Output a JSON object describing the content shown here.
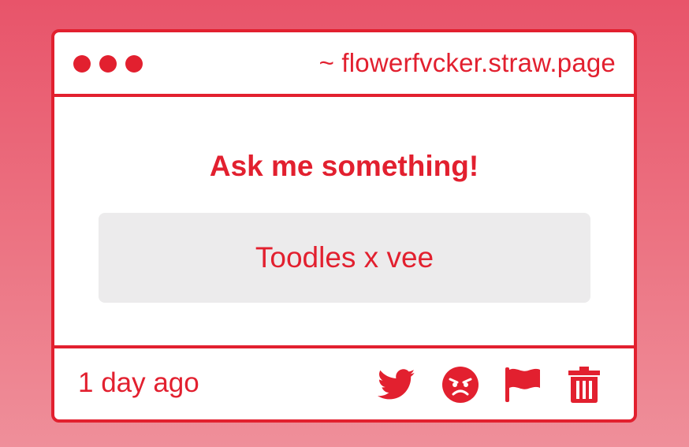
{
  "window": {
    "url": "~ flowerfvcker.straw.page"
  },
  "card": {
    "heading": "Ask me something!",
    "question": "Toodles x vee"
  },
  "footer": {
    "timestamp": "1 day ago",
    "actions": [
      {
        "icon": "twitter-icon"
      },
      {
        "icon": "angry-face-icon"
      },
      {
        "icon": "flag-icon"
      },
      {
        "icon": "trash-icon"
      }
    ]
  },
  "colors": {
    "accent": "#e2202f",
    "background_top": "#e8546a",
    "background_bottom": "#ef8f9a",
    "question_box": "#ecebec"
  }
}
